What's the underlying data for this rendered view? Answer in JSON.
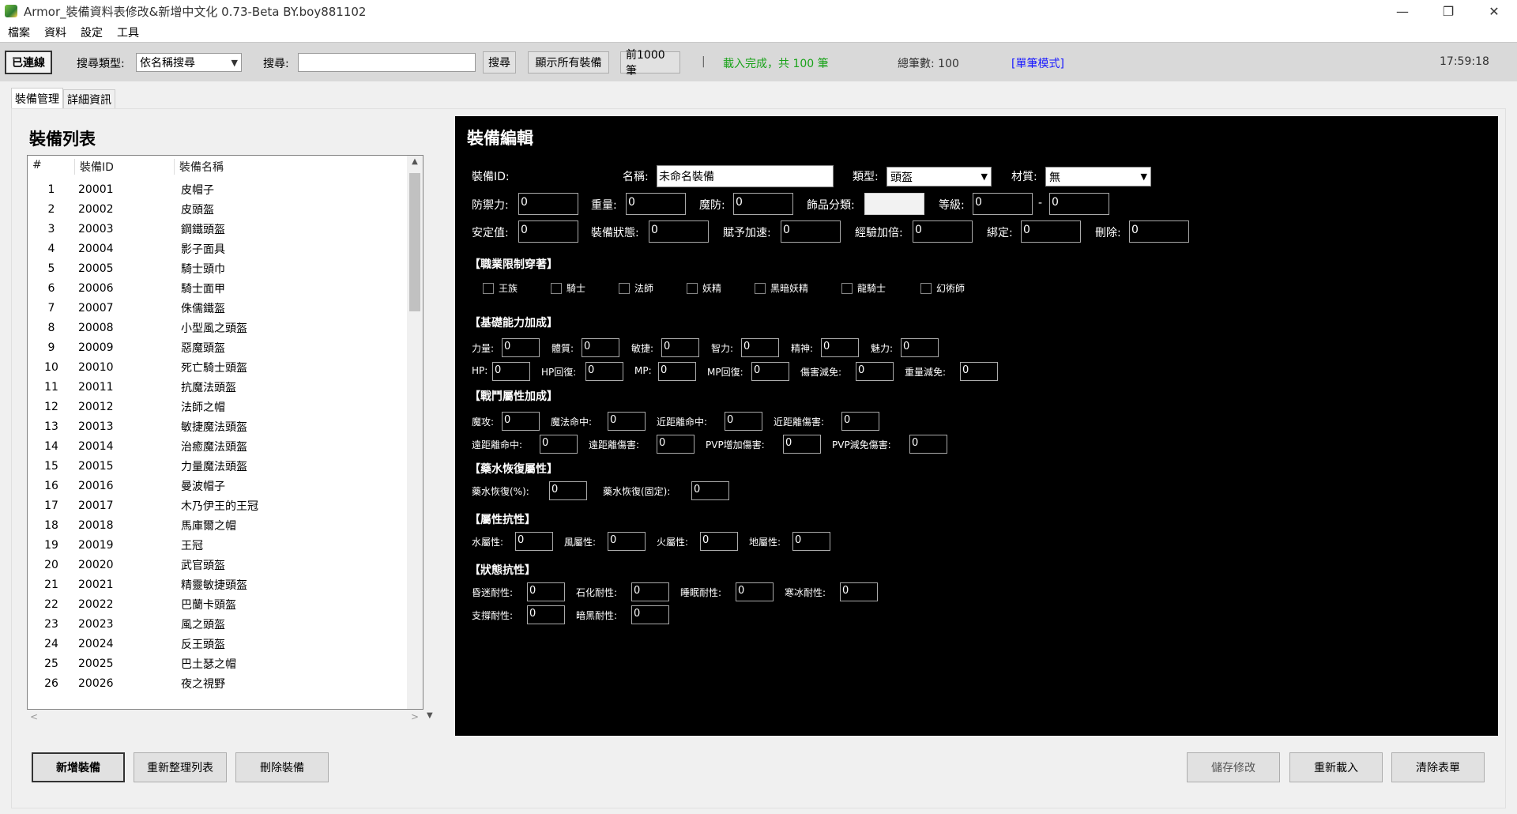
{
  "window": {
    "title": "Armor_裝備資料表修改&新增中文化 0.73-Beta BY.boy881102",
    "controls": [
      "—",
      "❐",
      "✕"
    ]
  },
  "menu": [
    "檔案",
    "資料",
    "設定",
    "工具"
  ],
  "toolbar": {
    "connect_label": "已連線",
    "search_type_label": "搜尋類型:",
    "search_type_value": "依名稱搜尋",
    "search_label": "搜尋:",
    "search_value": "",
    "search_button": "搜尋",
    "show_all_button": "顯示所有裝備",
    "first1000_button": "前1000筆",
    "separator": "|",
    "status": "載入完成，共 100 筆",
    "total": "總筆數: 100",
    "mode": "[單筆模式]",
    "time": "17:59:18"
  },
  "colors": {
    "status_green": "#1aa31a",
    "mode_blue": "#1a1aff",
    "editor_bg": "#000000"
  },
  "tabs": [
    "裝備管理",
    "詳細資訊"
  ],
  "list": {
    "title": "裝備列表",
    "columns": [
      "#",
      "裝備ID",
      "裝備名稱"
    ],
    "rows": [
      [
        "1",
        "20001",
        "皮帽子"
      ],
      [
        "2",
        "20002",
        "皮頭盔"
      ],
      [
        "3",
        "20003",
        "鋼鐵頭盔"
      ],
      [
        "4",
        "20004",
        "影子面具"
      ],
      [
        "5",
        "20005",
        "騎士頭巾"
      ],
      [
        "6",
        "20006",
        "騎士面甲"
      ],
      [
        "7",
        "20007",
        "侏儒鐵盔"
      ],
      [
        "8",
        "20008",
        "小型風之頭盔"
      ],
      [
        "9",
        "20009",
        "惡魔頭盔"
      ],
      [
        "10",
        "20010",
        "死亡騎士頭盔"
      ],
      [
        "11",
        "20011",
        "抗魔法頭盔"
      ],
      [
        "12",
        "20012",
        "法師之帽"
      ],
      [
        "13",
        "20013",
        "敏捷魔法頭盔"
      ],
      [
        "14",
        "20014",
        "治癒魔法頭盔"
      ],
      [
        "15",
        "20015",
        "力量魔法頭盔"
      ],
      [
        "16",
        "20016",
        "曼波帽子"
      ],
      [
        "17",
        "20017",
        "木乃伊王的王冠"
      ],
      [
        "18",
        "20018",
        "馬庫爾之帽"
      ],
      [
        "19",
        "20019",
        "王冠"
      ],
      [
        "20",
        "20020",
        "武官頭盔"
      ],
      [
        "21",
        "20021",
        "精靈敏捷頭盔"
      ],
      [
        "22",
        "20022",
        "巴蘭卡頭盔"
      ],
      [
        "23",
        "20023",
        "風之頭盔"
      ],
      [
        "24",
        "20024",
        "反王頭盔"
      ],
      [
        "25",
        "20025",
        "巴土瑟之帽"
      ],
      [
        "26",
        "20026",
        "夜之視野"
      ]
    ]
  },
  "editor": {
    "title": "裝備編輯",
    "row1": {
      "id_label": "裝備ID:",
      "name_label": "名稱:",
      "name_value": "未命名裝備",
      "type_label": "類型:",
      "type_value": "頭盔",
      "material_label": "材質:",
      "material_value": "無"
    },
    "row2": {
      "def_label": "防禦力:",
      "def_value": "0",
      "weight_label": "重量:",
      "weight_value": "0",
      "mr_label": "魔防:",
      "mr_value": "0",
      "acc_label": "飾品分類:",
      "acc_value": "",
      "lvl_label": "等級:",
      "lvl_min": "0",
      "lvl_dash": "-",
      "lvl_max": "0"
    },
    "row3": {
      "stab_label": "安定值:",
      "stab_value": "0",
      "state_label": "裝備狀態:",
      "state_value": "0",
      "haste_label": "賦予加速:",
      "haste_value": "0",
      "exp_label": "經驗加倍:",
      "exp_value": "0",
      "bind_label": "綁定:",
      "bind_value": "0",
      "del_label": "刪除:",
      "del_value": "0"
    },
    "class_section": "【職業限制穿著】",
    "classes": [
      "王族",
      "騎士",
      "法師",
      "妖精",
      "黑暗妖精",
      "龍騎士",
      "幻術師"
    ],
    "base_section": "【基礎能力加成】",
    "base1": [
      [
        "力量:",
        "0"
      ],
      [
        "體質:",
        "0"
      ],
      [
        "敏捷:",
        "0"
      ],
      [
        "智力:",
        "0"
      ],
      [
        "精神:",
        "0"
      ],
      [
        "魅力:",
        "0"
      ]
    ],
    "base2": [
      [
        "HP:",
        "0"
      ],
      [
        "HP回復:",
        "0"
      ],
      [
        "MP:",
        "0"
      ],
      [
        "MP回復:",
        "0"
      ],
      [
        "傷害減免:",
        "0"
      ],
      [
        "重量減免:",
        "0"
      ]
    ],
    "combat_section": "【戰鬥屬性加成】",
    "combat1": [
      [
        "魔攻:",
        "0"
      ],
      [
        "魔法命中:",
        "0"
      ],
      [
        "近距離命中:",
        "0"
      ],
      [
        "近距離傷害:",
        "0"
      ]
    ],
    "combat2": [
      [
        "遠距離命中:",
        "0"
      ],
      [
        "遠距離傷害:",
        "0"
      ],
      [
        "PVP增加傷害:",
        "0"
      ],
      [
        "PVP減免傷害:",
        "0"
      ]
    ],
    "potion_section": "【藥水恢復屬性】",
    "potion": [
      [
        "藥水恢復(%):",
        "0"
      ],
      [
        "藥水恢復(固定):",
        "0"
      ]
    ],
    "resist_section": "【屬性抗性】",
    "resist": [
      [
        "水屬性:",
        "0"
      ],
      [
        "風屬性:",
        "0"
      ],
      [
        "火屬性:",
        "0"
      ],
      [
        "地屬性:",
        "0"
      ]
    ],
    "status_section": "【狀態抗性】",
    "status1": [
      [
        "昏迷耐性:",
        "0"
      ],
      [
        "石化耐性:",
        "0"
      ],
      [
        "睡眠耐性:",
        "0"
      ],
      [
        "寒冰耐性:",
        "0"
      ]
    ],
    "status2": [
      [
        "支撐耐性:",
        "0"
      ],
      [
        "暗黑耐性:",
        "0"
      ]
    ]
  },
  "bottom": {
    "add": "新增裝備",
    "refresh": "重新整理列表",
    "delete": "刪除裝備",
    "save": "儲存修改",
    "reload": "重新載入",
    "clear": "清除表單"
  }
}
